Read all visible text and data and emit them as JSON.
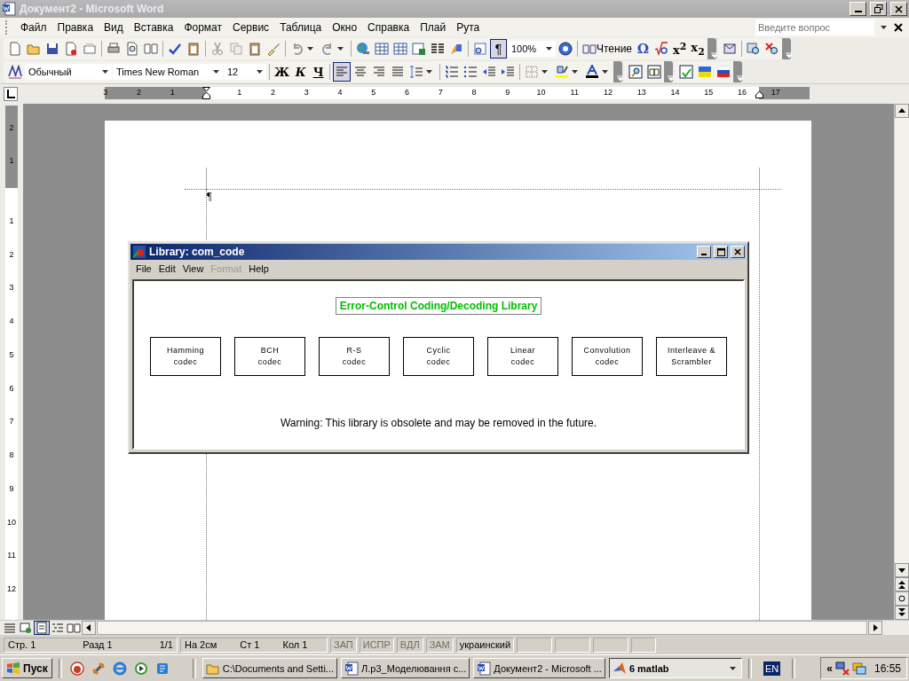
{
  "window": {
    "title": "Документ2 - Microsoft Word"
  },
  "menu": [
    "Файл",
    "Правка",
    "Вид",
    "Вставка",
    "Формат",
    "Сервис",
    "Таблица",
    "Окно",
    "Справка",
    "Плай",
    "Рута"
  ],
  "help_box": {
    "placeholder": "Введите вопрос"
  },
  "standard_toolbar": {
    "pilcrow": "¶",
    "pilcrow_pressed": true,
    "zoom": "100%",
    "reading": "Чтение",
    "omega": "Ω",
    "superscript": "x$^{2}$",
    "subscript": "x$_{2}$"
  },
  "formatting_toolbar": {
    "style": "Обычный",
    "font": "Times New Roman",
    "size": "12",
    "bold": "Ж",
    "italic": "К",
    "underline": "Ч",
    "alignment": [
      {
        "selected": true
      },
      {
        "selected": false
      },
      {
        "selected": false
      },
      {
        "selected": false
      }
    ]
  },
  "ruler": {
    "left_numbers": [
      "3",
      "2",
      "1"
    ],
    "numbers": [
      "1",
      "2",
      "3",
      "4",
      "5",
      "6",
      "7",
      "8",
      "9",
      "10",
      "11",
      "12",
      "13",
      "14",
      "15",
      "16"
    ],
    "right_numbers": [
      "17"
    ]
  },
  "vertical_ruler": {
    "top_numbers": [
      "2",
      "1"
    ],
    "numbers": [
      "1",
      "2",
      "3",
      "4",
      "5",
      "6",
      "7",
      "8",
      "9",
      "10",
      "11",
      "12"
    ]
  },
  "document": {
    "paragraph_mark": "¶"
  },
  "library_window": {
    "title": "Library: com_code",
    "menu": [
      {
        "label": "File",
        "disabled": false
      },
      {
        "label": "Edit",
        "disabled": false
      },
      {
        "label": "View",
        "disabled": false
      },
      {
        "label": "Format",
        "disabled": true
      },
      {
        "label": "Help",
        "disabled": false
      }
    ],
    "heading": "Error-Control Coding/Decoding Library",
    "blocks": [
      {
        "lines": [
          "Hamming",
          "codec"
        ]
      },
      {
        "lines": [
          "BCH",
          "codec"
        ]
      },
      {
        "lines": [
          "R-S",
          "codec"
        ]
      },
      {
        "lines": [
          "Cyclic",
          "codec"
        ]
      },
      {
        "lines": [
          "Linear",
          "codec"
        ]
      },
      {
        "lines": [
          "Convolution",
          "codec"
        ]
      },
      {
        "lines": [
          "Interleave &",
          "Scrambler"
        ]
      }
    ],
    "warning": "Warning: This library is obsolete and may be removed in the future."
  },
  "view_buttons": [
    {
      "selected": false
    },
    {
      "selected": false
    },
    {
      "selected": true
    },
    {
      "selected": false
    },
    {
      "selected": false
    }
  ],
  "status_bar": {
    "fields": [
      {
        "text": "Стр. 1"
      },
      {
        "text": "Разд 1"
      },
      {
        "text": "1/1"
      },
      {
        "text": "На 2см"
      },
      {
        "text": "Ст 1"
      },
      {
        "text": "Кол 1"
      }
    ],
    "modes": [
      {
        "label": "ЗАП",
        "disabled": true
      },
      {
        "label": "ИСПР",
        "disabled": true
      },
      {
        "label": "ВДЛ",
        "disabled": true
      },
      {
        "label": "ЗАМ",
        "disabled": true
      }
    ],
    "language": "украинский"
  },
  "taskbar": {
    "start": "Пуск",
    "tasks": [
      {
        "label": "C:\\Documents and Setti...",
        "kind": "folder",
        "selected": false
      },
      {
        "label": "Л.р3_Моделювання с...",
        "kind": "word",
        "selected": false
      },
      {
        "label": "Документ2 - Microsoft ...",
        "kind": "word",
        "selected": false
      },
      {
        "label": "6 matlab",
        "kind": "matlab",
        "selected": true
      }
    ],
    "language": "EN",
    "tray_chevron": "«",
    "clock": "16:55"
  }
}
